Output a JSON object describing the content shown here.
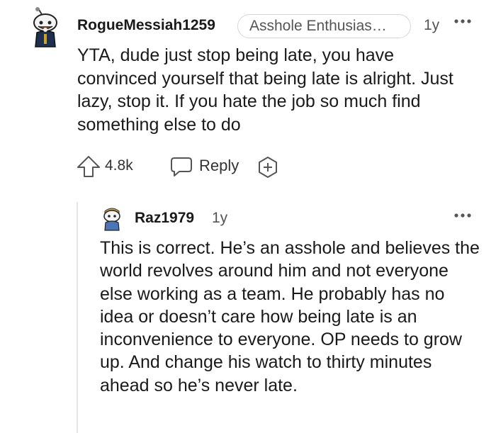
{
  "comment": {
    "username": "RogueMessiah1259",
    "flair": "Asshole Enthusias…",
    "time": "1y",
    "avatar_icon": "snoo-avatar-icon",
    "more_icon": "more-dots-icon",
    "body": "YTA, dude just stop being late, you have convinced yourself that being late is alright. Just lazy, stop it. If you hate the job so much find something else to do",
    "score": "4.8k",
    "reply_label": "Reply"
  },
  "reply": {
    "username": "Raz1979",
    "time": "1y",
    "avatar_icon": "snoo-avatar-icon",
    "more_icon": "more-dots-icon",
    "body": "This is correct. He’s an asshole and believes the world revolves around him and not everyone else working as a team. He probably has no idea or doesn’t care how being late is an inconvenience to everyone. OP needs to grow up. And change his watch to thirty minutes ahead so he’s never late."
  },
  "colors": {
    "text": "#1a1a1b",
    "meta": "#555555",
    "thread_line": "#e5e5e5"
  }
}
